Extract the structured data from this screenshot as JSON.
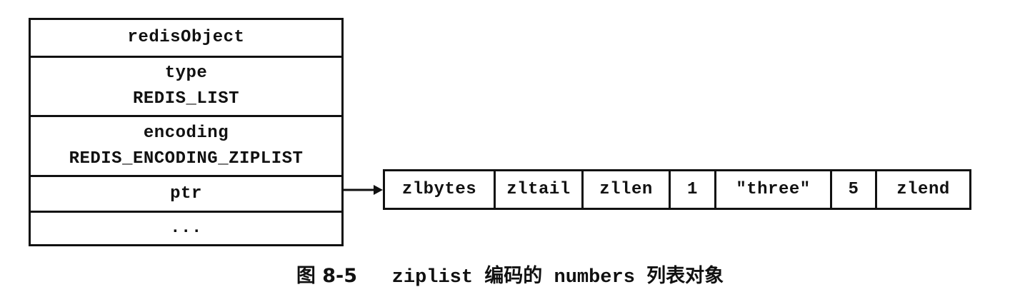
{
  "redis_object": {
    "title": "redisObject",
    "type_label": "type",
    "type_value": "REDIS_LIST",
    "encoding_label": "encoding",
    "encoding_value": "REDIS_ENCODING_ZIPLIST",
    "ptr_label": "ptr",
    "more_label": "..."
  },
  "ziplist": {
    "cells": [
      "zlbytes",
      "zltail",
      "zllen",
      "1",
      "\"three\"",
      "5",
      "zlend"
    ]
  },
  "caption": {
    "figure_number": "图 8-5",
    "name_part1": "ziplist",
    "cjk_part1": "编码的",
    "name_part2": "numbers",
    "cjk_part2": "列表对象"
  }
}
